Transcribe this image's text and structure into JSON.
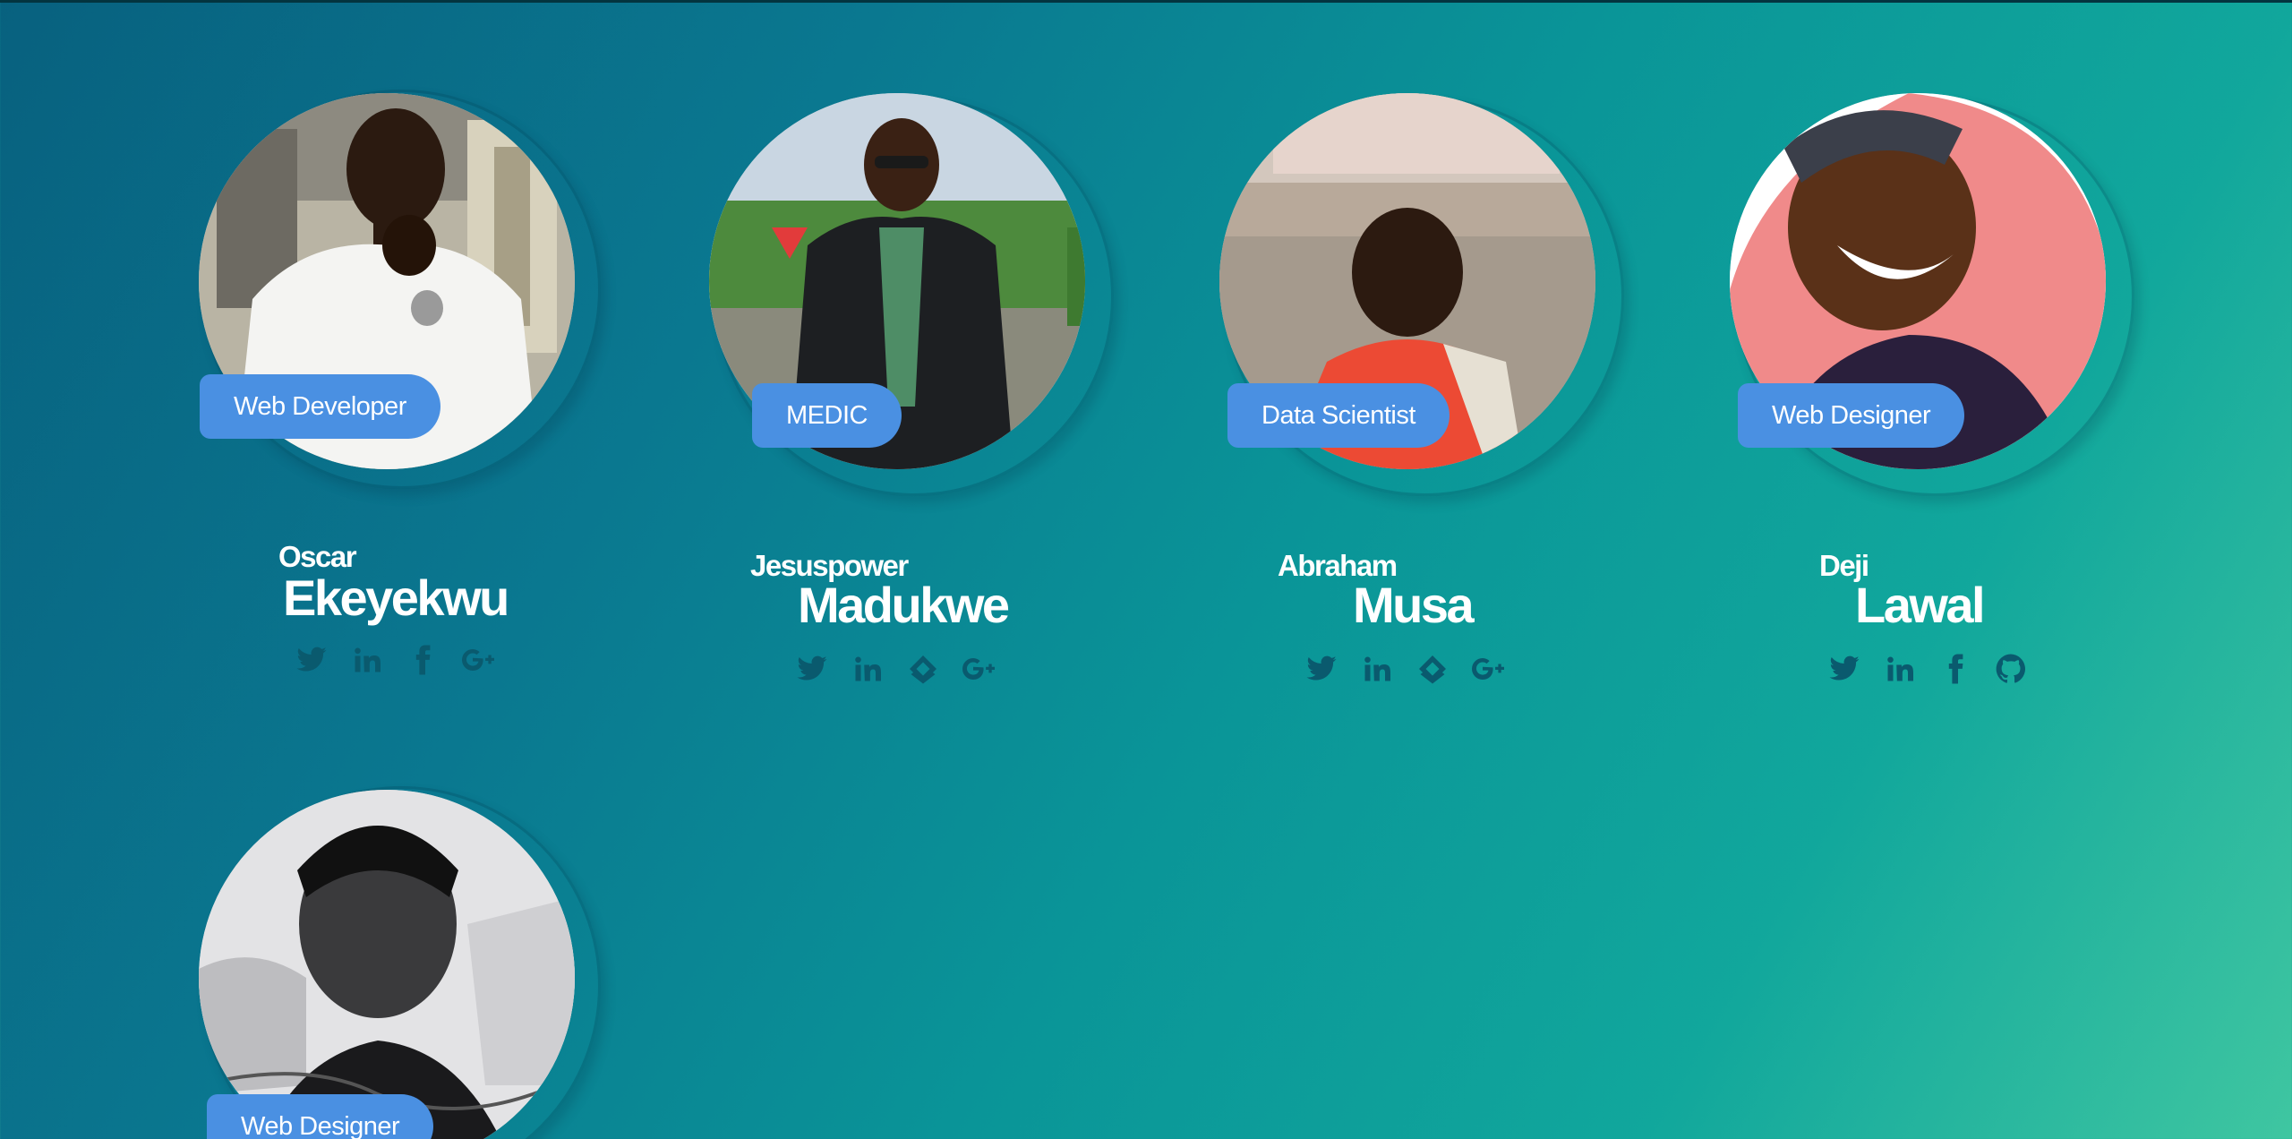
{
  "members": [
    {
      "role": "Web Developer",
      "first_name": "Oscar",
      "last_name": "Ekeyekwu",
      "socials": [
        "twitter-icon",
        "linkedin-icon",
        "facebook-icon",
        "google-plus-icon"
      ]
    },
    {
      "role": "MEDIC",
      "first_name": "Jesuspower",
      "last_name": "Madukwe",
      "socials": [
        "twitter-icon",
        "linkedin-icon",
        "stack-icon",
        "google-plus-icon"
      ]
    },
    {
      "role": "Data Scientist",
      "first_name": "Abraham",
      "last_name": "Musa",
      "socials": [
        "twitter-icon",
        "linkedin-icon",
        "stack-icon",
        "google-plus-icon"
      ]
    },
    {
      "role": "Web Designer",
      "first_name": "Deji",
      "last_name": "Lawal",
      "socials": [
        "twitter-icon",
        "linkedin-icon",
        "facebook-icon",
        "github-icon"
      ]
    },
    {
      "role": "Web Designer",
      "first_name": "",
      "last_name": "",
      "socials": []
    }
  ],
  "colors": {
    "accent": "#4a90e2",
    "icon": "#0a5a6e",
    "text": "#ffffff"
  }
}
